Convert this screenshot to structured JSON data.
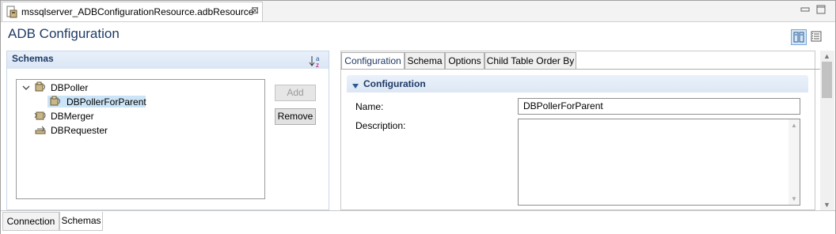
{
  "editor_tab": {
    "label": "mssqlserver_ADBConfigurationResource.adbResource",
    "close": "⊠"
  },
  "window_controls": {
    "minimize": "▭",
    "maximize": "□"
  },
  "page_title": "ADB Configuration",
  "schemas_section": {
    "title": "Schemas",
    "sort_icon": "↓a z",
    "tree": {
      "items": [
        {
          "label": "DBPoller",
          "expanded": true,
          "icon": "db-poller-icon"
        },
        {
          "label": "DBPollerForParent",
          "selected": true,
          "icon": "db-poller-icon"
        },
        {
          "label": "DBMerger",
          "icon": "db-merger-icon"
        },
        {
          "label": "DBRequester",
          "icon": "db-requester-icon"
        }
      ]
    },
    "buttons": {
      "add": "Add",
      "remove": "Remove"
    }
  },
  "detail_tabs": [
    "Configuration",
    "Schema",
    "Options",
    "Child Table Order By"
  ],
  "configuration": {
    "section_title": "Configuration",
    "name_label": "Name:",
    "name_value": "DBPollerForParent",
    "description_label": "Description:",
    "description_value": ""
  },
  "bottom_tabs": [
    "Connection",
    "Schemas"
  ],
  "colors": {
    "title": "#1f3a66",
    "selection": "#cce4f7",
    "section_header": "#dbe6f4"
  }
}
